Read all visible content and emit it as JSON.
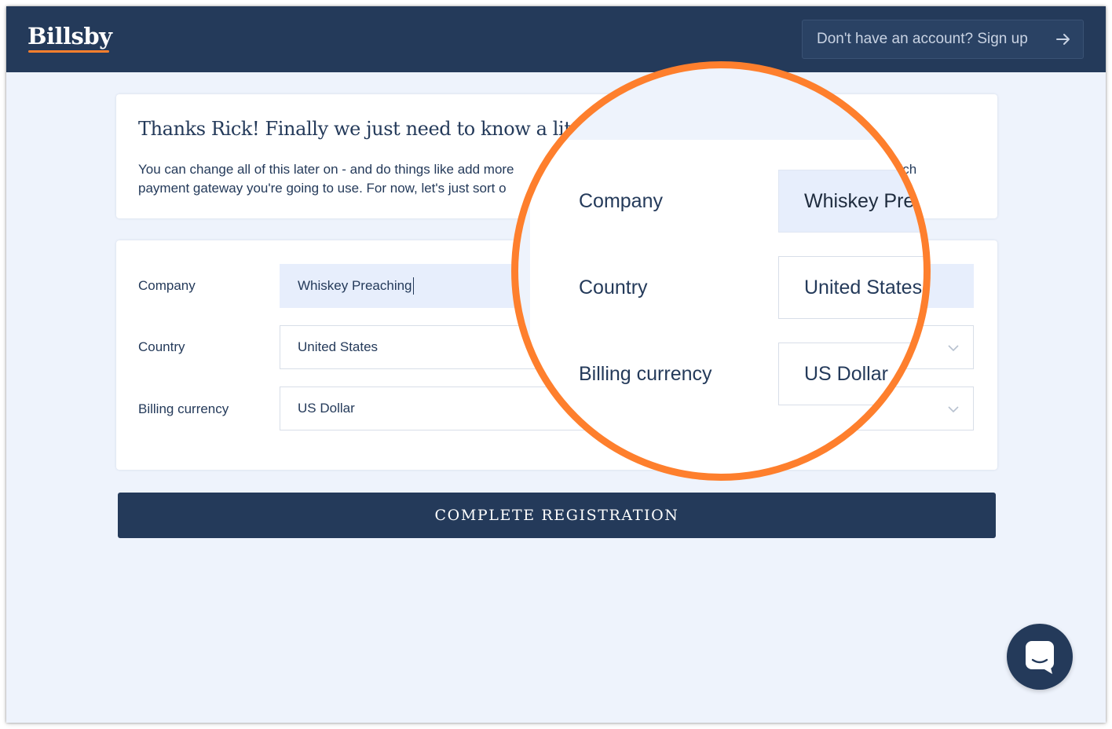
{
  "header": {
    "logo": "Billsby",
    "signup_label": "Don't have an account? Sign up"
  },
  "intro": {
    "heading": "Thanks Rick! Finally we just need to know a little",
    "para_line1": "You can change all of this later on - and do things like add more",
    "para_line1_tail": "hich",
    "para_line2": "payment gateway you're going to use. For now, let's just sort o"
  },
  "form": {
    "company_label": "Company",
    "company_value": "Whiskey Preaching",
    "country_label": "Country",
    "country_value": "United States",
    "currency_label": "Billing currency",
    "currency_value": "US Dollar"
  },
  "magnified": {
    "company_label": "Company",
    "company_value": "Whiskey Preac",
    "country_label": "Country",
    "country_value": "United States",
    "currency_label": "Billing currency",
    "currency_value": "US Dollar"
  },
  "cta_label": "COMPLETE REGISTRATION",
  "colors": {
    "navy": "#243a5a",
    "accent": "#fe7f2d",
    "page_bg": "#eef3fc",
    "active_input": "#e7eefc"
  },
  "icons": {
    "signup": "arrow-right-icon",
    "select": "chevron-down-icon",
    "chat": "chat-bubble-icon"
  }
}
